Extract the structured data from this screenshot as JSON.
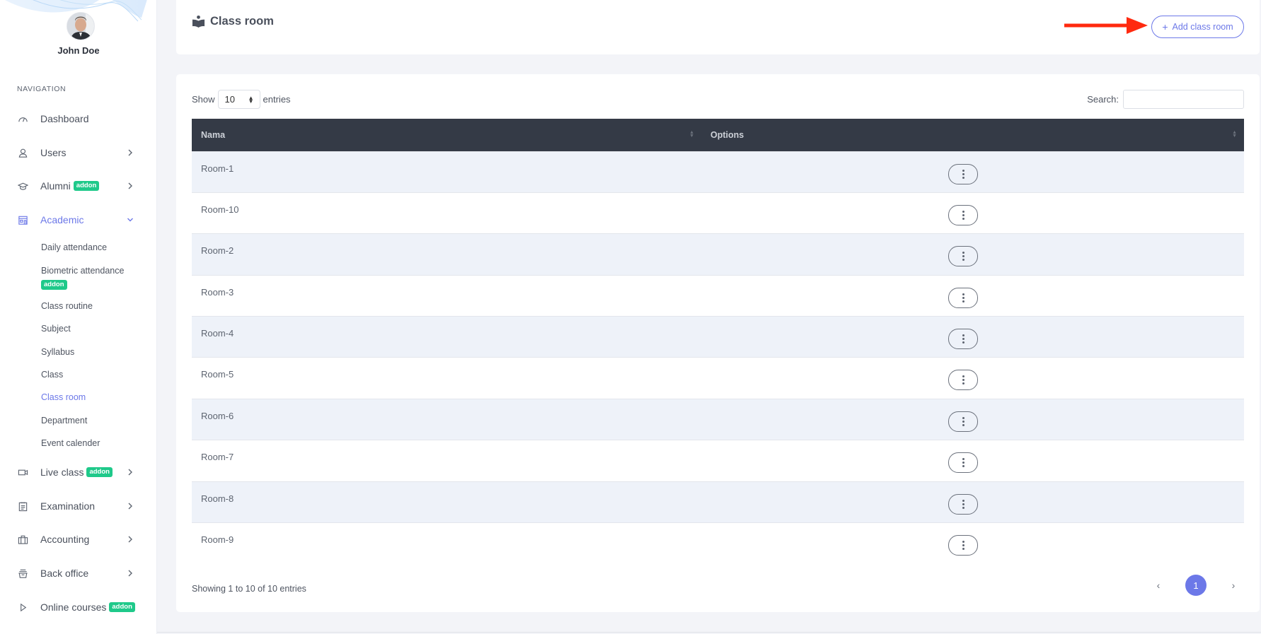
{
  "user": {
    "name": "John Doe",
    "avatar_icon": "user-photo"
  },
  "sidebar": {
    "heading": "NAVIGATION",
    "items": [
      {
        "label": "Dashboard",
        "icon": "dashboard-gauge-icon",
        "badge": null,
        "chevron": false
      },
      {
        "label": "Users",
        "icon": "user-icon",
        "badge": null,
        "chevron": "right"
      },
      {
        "label": "Alumni",
        "icon": "graduation-cap-icon",
        "badge": "addon",
        "chevron": "right"
      },
      {
        "label": "Academic",
        "icon": "school-building-icon",
        "badge": null,
        "chevron": "down",
        "active": true
      },
      {
        "label": "Live class",
        "icon": "video-camera-icon",
        "badge": "addon",
        "chevron": "right"
      },
      {
        "label": "Examination",
        "icon": "clipboard-icon",
        "badge": null,
        "chevron": "right"
      },
      {
        "label": "Accounting",
        "icon": "briefcase-icon",
        "badge": null,
        "chevron": "right"
      },
      {
        "label": "Back office",
        "icon": "inbox-tray-icon",
        "badge": null,
        "chevron": "right"
      },
      {
        "label": "Online courses",
        "icon": "play-icon",
        "badge": "addon",
        "chevron": false
      }
    ],
    "academic_sub": [
      {
        "label": "Daily attendance"
      },
      {
        "label": "Biometric attendance",
        "badge": "addon"
      },
      {
        "label": "Class routine"
      },
      {
        "label": "Subject"
      },
      {
        "label": "Syllabus"
      },
      {
        "label": "Class"
      },
      {
        "label": "Class room",
        "active": true
      },
      {
        "label": "Department"
      },
      {
        "label": "Event calender"
      }
    ]
  },
  "header": {
    "title": "Class room",
    "title_icon": "book-reader-icon",
    "add_button": "Add class room",
    "add_icon": "+"
  },
  "table_controls": {
    "show_label": "Show",
    "entries_label": "entries",
    "page_length": "10",
    "search_label": "Search:",
    "search_value": ""
  },
  "table": {
    "columns": [
      "Nama",
      "Options"
    ],
    "rows": [
      {
        "name": "Room-1"
      },
      {
        "name": "Room-10"
      },
      {
        "name": "Room-2"
      },
      {
        "name": "Room-3"
      },
      {
        "name": "Room-4"
      },
      {
        "name": "Room-5"
      },
      {
        "name": "Room-6"
      },
      {
        "name": "Room-7"
      },
      {
        "name": "Room-8"
      },
      {
        "name": "Room-9"
      }
    ]
  },
  "footer": {
    "info": "Showing 1 to 10 of 10 entries",
    "prev": "‹",
    "current_page": "1",
    "next": "›"
  },
  "colors": {
    "accent": "#6c78e8",
    "addon_badge": "#1fc98a",
    "table_header": "#343a46",
    "annotation_arrow": "#ff2a0f"
  }
}
